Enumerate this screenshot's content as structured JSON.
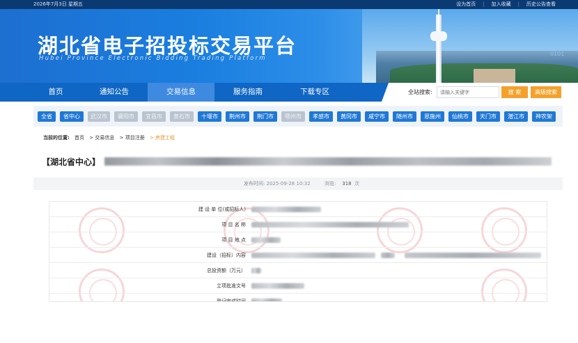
{
  "topbar": {
    "date": "2026年7月3日 星期五",
    "links": [
      "设为首页",
      "加入收藏",
      "历史公告查看"
    ]
  },
  "banner": {
    "title": "湖北省电子招投标交易平台",
    "subtitle": "Hubei Province Electronic Bidding Trading Platform",
    "deco": "0101"
  },
  "nav": {
    "items": [
      "首页",
      "通知公告",
      "交易信息",
      "服务指南",
      "下载专区"
    ],
    "active_index": 2,
    "search_label": "全站搜索:",
    "search_placeholder": "请输入关键字",
    "search_button": "搜 索",
    "advanced_button": "高级搜索"
  },
  "regions": [
    {
      "name": "全省",
      "enabled": true
    },
    {
      "name": "省中心",
      "enabled": true
    },
    {
      "name": "武汉市",
      "enabled": false
    },
    {
      "name": "襄阳市",
      "enabled": false
    },
    {
      "name": "宜昌市",
      "enabled": false
    },
    {
      "name": "黄石市",
      "enabled": false
    },
    {
      "name": "十堰市",
      "enabled": true
    },
    {
      "name": "荆州市",
      "enabled": true
    },
    {
      "name": "荆门市",
      "enabled": true
    },
    {
      "name": "鄂州市",
      "enabled": false
    },
    {
      "name": "孝感市",
      "enabled": true
    },
    {
      "name": "黄冈市",
      "enabled": true
    },
    {
      "name": "咸宁市",
      "enabled": true
    },
    {
      "name": "随州市",
      "enabled": true
    },
    {
      "name": "恩施州",
      "enabled": true
    },
    {
      "name": "仙桃市",
      "enabled": true
    },
    {
      "name": "天门市",
      "enabled": true
    },
    {
      "name": "潜江市",
      "enabled": true
    },
    {
      "name": "神农架",
      "enabled": true
    }
  ],
  "breadcrumb": {
    "label": "当前的位置:",
    "items": [
      "首页",
      "> 交易信息",
      "> 项目注册",
      "> 房建工程"
    ]
  },
  "heading": {
    "prefix": "【湖北省中心】"
  },
  "meta": {
    "published": "发布时间: 2025-09-28 10:32",
    "views_label": "浏览:",
    "views_count": "318",
    "views_unit": "次"
  },
  "table": {
    "rows": [
      {
        "label": "建 设 单 位(或招标人)"
      },
      {
        "label": "项 目 名 称"
      },
      {
        "label": "项 目 地 点"
      },
      {
        "label": "建设（招标）内容"
      },
      {
        "label": "总投资额（万元）"
      },
      {
        "label": "立项批准文号"
      },
      {
        "label": "登记完成时间"
      }
    ]
  },
  "colors": {
    "nav_bg": "#0f66c4",
    "nav_active": "#3e8ae0",
    "accent_orange": "#f4a12b",
    "region_blue": "#1f78d6"
  }
}
